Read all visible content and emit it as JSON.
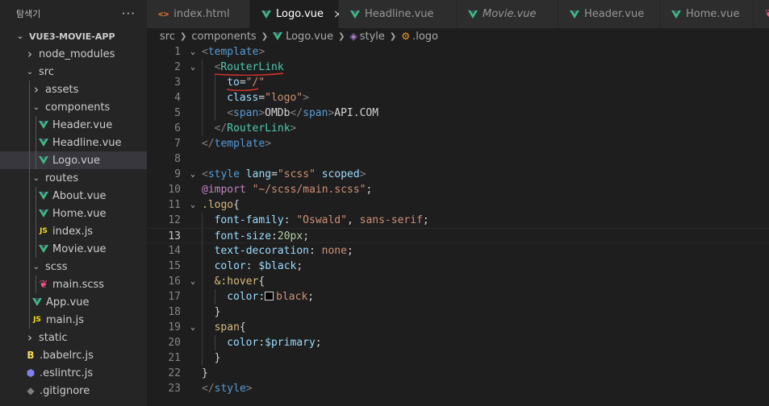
{
  "sidebar": {
    "header": "탐색기",
    "more": "···",
    "root": "VUE3-MOVIE-APP",
    "items": [
      {
        "label": "node_modules",
        "kind": "folder",
        "open": false,
        "depth": 0
      },
      {
        "label": "src",
        "kind": "folder",
        "open": true,
        "depth": 0
      },
      {
        "label": "assets",
        "kind": "folder",
        "open": false,
        "depth": 1
      },
      {
        "label": "components",
        "kind": "folder",
        "open": true,
        "depth": 1
      },
      {
        "label": "Header.vue",
        "kind": "vue",
        "depth": 2
      },
      {
        "label": "Headline.vue",
        "kind": "vue",
        "depth": 2
      },
      {
        "label": "Logo.vue",
        "kind": "vue",
        "depth": 2,
        "selected": true
      },
      {
        "label": "routes",
        "kind": "folder",
        "open": true,
        "depth": 1
      },
      {
        "label": "About.vue",
        "kind": "vue",
        "depth": 2
      },
      {
        "label": "Home.vue",
        "kind": "vue",
        "depth": 2
      },
      {
        "label": "index.js",
        "kind": "js",
        "depth": 2
      },
      {
        "label": "Movie.vue",
        "kind": "vue",
        "depth": 2
      },
      {
        "label": "scss",
        "kind": "folder",
        "open": true,
        "depth": 1
      },
      {
        "label": "main.scss",
        "kind": "scss",
        "depth": 2
      },
      {
        "label": "App.vue",
        "kind": "vue",
        "depth": 1
      },
      {
        "label": "main.js",
        "kind": "js",
        "depth": 1
      },
      {
        "label": "static",
        "kind": "folder",
        "open": false,
        "depth": 0
      },
      {
        "label": ".babelrc.js",
        "kind": "babel",
        "depth": 0
      },
      {
        "label": ".eslintrc.js",
        "kind": "eslint",
        "depth": 0
      },
      {
        "label": ".gitignore",
        "kind": "git",
        "depth": 0
      }
    ]
  },
  "tabs": [
    {
      "label": "index.html",
      "icon": "html-icon"
    },
    {
      "label": "Logo.vue",
      "icon": "vue-icon",
      "active": true,
      "close": "×"
    },
    {
      "label": "Headline.vue",
      "icon": "vue-icon"
    },
    {
      "label": "Movie.vue",
      "icon": "vue-icon",
      "italic": true
    },
    {
      "label": "Header.vue",
      "icon": "vue-icon"
    },
    {
      "label": "Home.vue",
      "icon": "vue-icon"
    }
  ],
  "breadcrumb": {
    "parts": [
      "src",
      "components",
      "Logo.vue",
      "style",
      ".logo"
    ]
  },
  "editor": {
    "active_line": 13,
    "lines": [
      {
        "n": "1",
        "fold": "⌄",
        "indent": 0,
        "tokens": [
          [
            "t-punc",
            "<"
          ],
          [
            "t-tag",
            "template"
          ],
          [
            "t-punc",
            ">"
          ]
        ]
      },
      {
        "n": "2",
        "fold": "⌄",
        "indent": 1,
        "tokens": [
          [
            "t-punc",
            "<"
          ],
          [
            "t-comp",
            "RouterLink"
          ]
        ]
      },
      {
        "n": "3",
        "indent": 2,
        "tokens": [
          [
            "t-attr",
            "to"
          ],
          [
            "t-text",
            "="
          ],
          [
            "t-str",
            "\"/\""
          ]
        ]
      },
      {
        "n": "4",
        "indent": 2,
        "tokens": [
          [
            "t-attr",
            "class"
          ],
          [
            "t-text",
            "="
          ],
          [
            "t-str",
            "\"logo\""
          ],
          [
            "t-punc",
            ">"
          ]
        ]
      },
      {
        "n": "5",
        "indent": 2,
        "tokens": [
          [
            "t-punc",
            "<"
          ],
          [
            "t-tag",
            "span"
          ],
          [
            "t-punc",
            ">"
          ],
          [
            "t-text",
            "OMDb"
          ],
          [
            "t-punc",
            "</"
          ],
          [
            "t-tag",
            "span"
          ],
          [
            "t-punc",
            ">"
          ],
          [
            "t-text",
            "API.COM"
          ]
        ]
      },
      {
        "n": "6",
        "indent": 1,
        "tokens": [
          [
            "t-punc",
            "</"
          ],
          [
            "t-comp",
            "RouterLink"
          ],
          [
            "t-punc",
            ">"
          ]
        ]
      },
      {
        "n": "7",
        "indent": 0,
        "tokens": [
          [
            "t-punc",
            "</"
          ],
          [
            "t-tag",
            "template"
          ],
          [
            "t-punc",
            ">"
          ]
        ]
      },
      {
        "n": "8",
        "indent": 0,
        "tokens": []
      },
      {
        "n": "9",
        "fold": "⌄",
        "indent": 0,
        "tokens": [
          [
            "t-punc",
            "<"
          ],
          [
            "t-tag",
            "style"
          ],
          [
            "t-text",
            " "
          ],
          [
            "t-attr",
            "lang"
          ],
          [
            "t-text",
            "="
          ],
          [
            "t-str",
            "\"scss\""
          ],
          [
            "t-text",
            " "
          ],
          [
            "t-attr",
            "scoped"
          ],
          [
            "t-punc",
            ">"
          ]
        ]
      },
      {
        "n": "10",
        "indent": 0,
        "tokens": [
          [
            "t-kw",
            "@import"
          ],
          [
            "t-text",
            " "
          ],
          [
            "t-str",
            "\"~/scss/main.scss\""
          ],
          [
            "t-text",
            ";"
          ]
        ]
      },
      {
        "n": "11",
        "fold": "⌄",
        "indent": 0,
        "tokens": [
          [
            "t-sel",
            ".logo"
          ],
          [
            "t-brace",
            "{"
          ]
        ]
      },
      {
        "n": "12",
        "indent": 1,
        "tokens": [
          [
            "t-prop",
            "font-family"
          ],
          [
            "t-text",
            ": "
          ],
          [
            "t-val",
            "\"Oswald\""
          ],
          [
            "t-text",
            ", "
          ],
          [
            "t-val",
            "sans-serif"
          ],
          [
            "t-text",
            ";"
          ]
        ]
      },
      {
        "n": "13",
        "indent": 1,
        "tokens": [
          [
            "t-prop",
            "font-size"
          ],
          [
            "t-text",
            ":"
          ],
          [
            "t-num",
            "20px"
          ],
          [
            "t-text",
            ";"
          ]
        ]
      },
      {
        "n": "14",
        "indent": 1,
        "tokens": [
          [
            "t-prop",
            "text-decoration"
          ],
          [
            "t-text",
            ": "
          ],
          [
            "t-val",
            "none"
          ],
          [
            "t-text",
            ";"
          ]
        ]
      },
      {
        "n": "15",
        "indent": 1,
        "tokens": [
          [
            "t-prop",
            "color"
          ],
          [
            "t-text",
            ": "
          ],
          [
            "t-var",
            "$black"
          ],
          [
            "t-text",
            ";"
          ]
        ]
      },
      {
        "n": "16",
        "fold": "⌄",
        "indent": 1,
        "tokens": [
          [
            "t-sel",
            "&:hover"
          ],
          [
            "t-brace",
            "{"
          ]
        ]
      },
      {
        "n": "17",
        "indent": 2,
        "tokens": [
          [
            "t-prop",
            "color"
          ],
          [
            "t-text",
            ":"
          ],
          [
            "swatch",
            ""
          ],
          [
            "t-val",
            "black"
          ],
          [
            "t-text",
            ";"
          ]
        ]
      },
      {
        "n": "18",
        "indent": 1,
        "tokens": [
          [
            "t-brace",
            "}"
          ]
        ]
      },
      {
        "n": "19",
        "fold": "⌄",
        "indent": 1,
        "tokens": [
          [
            "t-sel",
            "span"
          ],
          [
            "t-brace",
            "{"
          ]
        ]
      },
      {
        "n": "20",
        "indent": 2,
        "tokens": [
          [
            "t-prop",
            "color"
          ],
          [
            "t-text",
            ":"
          ],
          [
            "t-var",
            "$primary"
          ],
          [
            "t-text",
            ";"
          ]
        ]
      },
      {
        "n": "21",
        "indent": 1,
        "tokens": [
          [
            "t-brace",
            "}"
          ]
        ]
      },
      {
        "n": "22",
        "indent": 0,
        "tokens": [
          [
            "t-brace",
            "}"
          ]
        ]
      },
      {
        "n": "23",
        "indent": 0,
        "tokens": [
          [
            "t-punc",
            "</"
          ],
          [
            "t-tag",
            "style"
          ],
          [
            "t-punc",
            ">"
          ]
        ]
      }
    ]
  },
  "colors": {
    "background": "#1e1e1e",
    "sidebar": "#252526",
    "selected_item": "#37373d",
    "vue_green": "#41b883",
    "squiggle_red": "#d0312d"
  }
}
